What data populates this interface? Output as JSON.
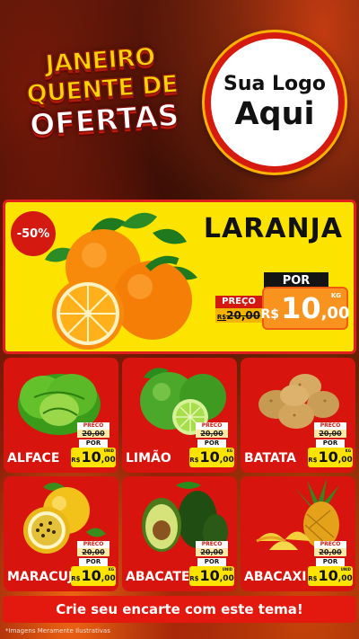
{
  "header": {
    "title_line1": "JANEIRO",
    "title_line2": "QUENTE DE",
    "title_line3": "OFERTAS",
    "logo_line1": "Sua Logo",
    "logo_line2": "Aqui"
  },
  "featured": {
    "name": "LARANJA",
    "discount": "-50%",
    "old_label": "PREÇO",
    "old_currency": "R$",
    "old_price": "20,00",
    "new_label": "POR",
    "currency": "R$",
    "price_int": "10",
    "price_dec": ",00",
    "unit": "KG"
  },
  "products": [
    {
      "name": "ALFACE",
      "old_label": "PRECO",
      "old_price": "20,00",
      "new_label": "POR",
      "currency": "R$",
      "price_int": "10",
      "price_dec": ",00",
      "unit": "UNID"
    },
    {
      "name": "LIMÃO",
      "old_label": "PRECO",
      "old_price": "20,00",
      "new_label": "POR",
      "currency": "R$",
      "price_int": "10",
      "price_dec": ",00",
      "unit": "KG"
    },
    {
      "name": "BATATA",
      "old_label": "PRECO",
      "old_price": "20,00",
      "new_label": "POR",
      "currency": "R$",
      "price_int": "10",
      "price_dec": ",00",
      "unit": "KG"
    },
    {
      "name": "MARACUJÁ",
      "old_label": "PRECO",
      "old_price": "20,00",
      "new_label": "POR",
      "currency": "R$",
      "price_int": "10",
      "price_dec": ",00",
      "unit": "KG"
    },
    {
      "name": "ABACATE",
      "old_label": "PRECO",
      "old_price": "20,00",
      "new_label": "POR",
      "currency": "R$",
      "price_int": "10",
      "price_dec": ",00",
      "unit": "UNID"
    },
    {
      "name": "ABACAXI",
      "old_label": "PRECO",
      "old_price": "20,00",
      "new_label": "POR",
      "currency": "R$",
      "price_int": "10",
      "price_dec": ",00",
      "unit": "UNID"
    }
  ],
  "cta": "Crie seu encarte com este tema!",
  "disclaimer": "*Imagens Meramente Ilustrativas",
  "colors": {
    "card_red": "#d7140e",
    "feature_yellow": "#fde400",
    "price_orange": "#f7931e",
    "price_yellow": "#fde400"
  },
  "icons": [
    "orange-image",
    "lettuce-image",
    "lime-image",
    "potato-image",
    "passion-fruit-image",
    "avocado-image",
    "pineapple-image"
  ]
}
